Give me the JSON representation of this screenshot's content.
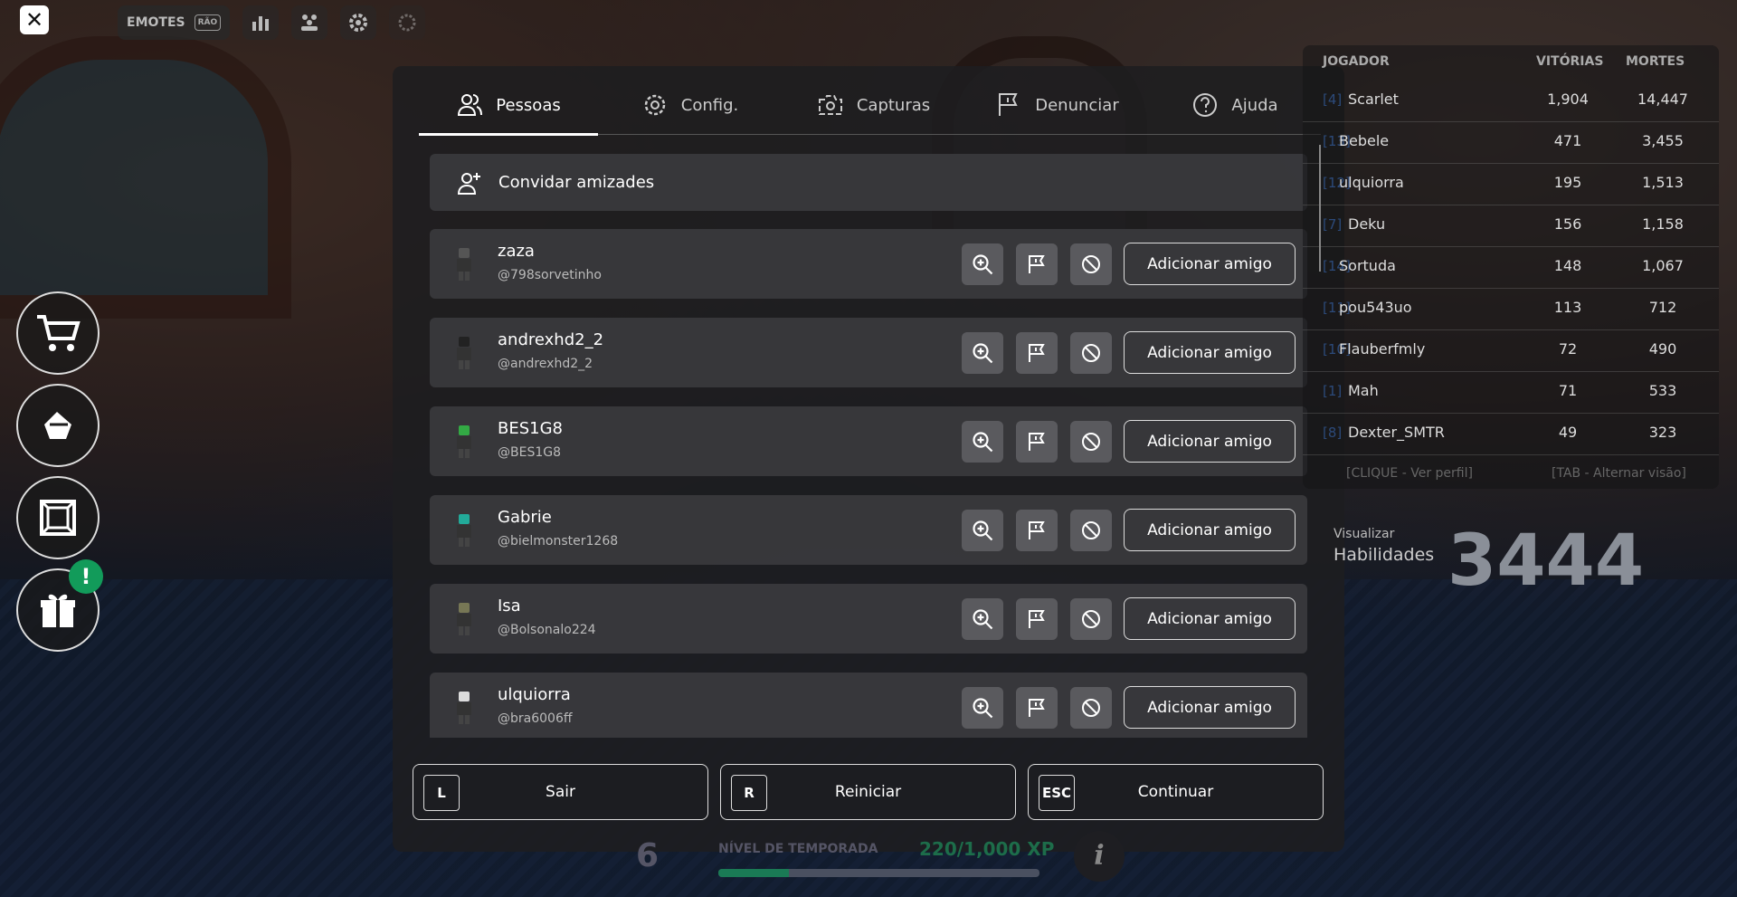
{
  "top": {
    "close_glyph": "✕",
    "emotes_label": "EMOTES",
    "emotes_key": "RÃO"
  },
  "tabs": [
    {
      "label": "Pessoas",
      "icon": "people-icon",
      "active": true
    },
    {
      "label": "Config.",
      "icon": "gear-icon",
      "active": false
    },
    {
      "label": "Capturas",
      "icon": "camera-icon",
      "active": false
    },
    {
      "label": "Denunciar",
      "icon": "flag-icon",
      "active": false
    },
    {
      "label": "Ajuda",
      "icon": "help-icon",
      "active": false
    }
  ],
  "invite": {
    "label": "Convidar amizades",
    "icon": "add-person-icon"
  },
  "players": [
    {
      "name": "zaza",
      "handle": "@798sorvetinho",
      "action": "Adicionar amigo"
    },
    {
      "name": "andrexhd2_2",
      "handle": "@andrexhd2_2",
      "action": "Adicionar amigo"
    },
    {
      "name": "BES1G8",
      "handle": "@BES1G8",
      "action": "Adicionar amigo"
    },
    {
      "name": "Gabrie",
      "handle": "@bielmonster1268",
      "action": "Adicionar amigo"
    },
    {
      "name": "Isa",
      "handle": "@Bolsonalo224",
      "action": "Adicionar amigo"
    },
    {
      "name": "ulquiorra",
      "handle": "@bra6006ff",
      "action": "Adicionar amigo"
    }
  ],
  "bottom": [
    {
      "key": "L",
      "label": "Sair"
    },
    {
      "key": "R",
      "label": "Reiniciar"
    },
    {
      "key": "ESC",
      "label": "Continuar"
    }
  ],
  "season": {
    "level": "6",
    "label": "NÍVEL DE TEMPORADA",
    "xp_text": "220/1,000 XP",
    "progress": 0.22,
    "info_glyph": "i"
  },
  "leaderboard": {
    "headers": {
      "player": "JOGADOR",
      "wins": "VITÓRIAS",
      "deaths": "MORTES"
    },
    "rows": [
      {
        "rank": "[4]",
        "name": "Scarlet",
        "wins": "1,904",
        "deaths": "14,447"
      },
      {
        "rank": "[13]",
        "name": "Bebele",
        "wins": "471",
        "deaths": "3,455"
      },
      {
        "rank": "[12]",
        "name": "ulquiorra",
        "wins": "195",
        "deaths": "1,513"
      },
      {
        "rank": "[7]",
        "name": "Deku",
        "wins": "156",
        "deaths": "1,158"
      },
      {
        "rank": "[14]",
        "name": "Sortuda",
        "wins": "148",
        "deaths": "1,067"
      },
      {
        "rank": "[11]",
        "name": "pou543uo",
        "wins": "113",
        "deaths": "712"
      },
      {
        "rank": "[10]",
        "name": "Flauberfmly",
        "wins": "72",
        "deaths": "490"
      },
      {
        "rank": "[1]",
        "name": "Mah",
        "wins": "71",
        "deaths": "533"
      },
      {
        "rank": "[8]",
        "name": "Dexter_SMTR",
        "wins": "49",
        "deaths": "323"
      }
    ],
    "footer_left": "[CLIQUE - Ver perfil]",
    "footer_right": "[TAB - Alternar visão]"
  },
  "habilidades": {
    "small": "Visualizar",
    "big": "Habilidades",
    "number": "3444"
  },
  "colors": {
    "accent_green": "#129b5a",
    "panel": "#1e1e20",
    "row": "#3c3c40"
  }
}
